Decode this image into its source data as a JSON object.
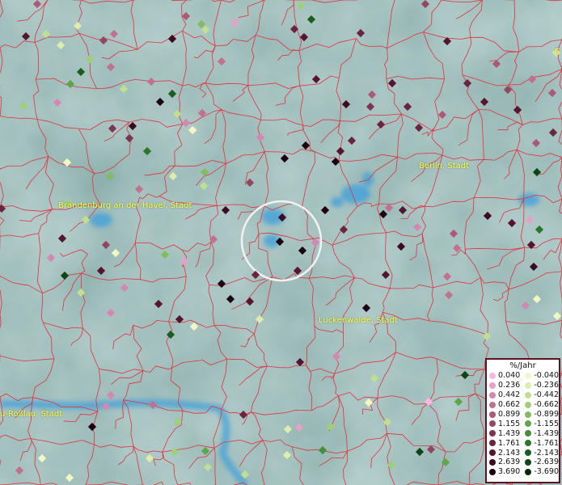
{
  "map": {
    "place_labels": [
      {
        "id": "brandenburg",
        "text": "Brandenburg an der Havel, Stadt"
      },
      {
        "id": "berlin",
        "text": "Berlin, Stadt"
      },
      {
        "id": "luckenwalde",
        "text": "Luckenwalde, Stadt"
      },
      {
        "id": "rosslau",
        "text": "u-Roßlau, Stadt"
      },
      {
        "id": "edge_e",
        "text": "E"
      }
    ],
    "colors": {
      "background": "#8fb1ae",
      "boundary": "#e0323c",
      "water": "#4aa3d8",
      "selection_circle": "#f2f2f2"
    }
  },
  "legend": {
    "title": "%/Jahr",
    "positive": [
      {
        "label": "0.040",
        "color": "#f5b8e0"
      },
      {
        "label": "0.236",
        "color": "#e89fc8"
      },
      {
        "label": "0.442",
        "color": "#d487b0"
      },
      {
        "label": "0.662",
        "color": "#c2708f"
      },
      {
        "label": "0.899",
        "color": "#aa5a78"
      },
      {
        "label": "1.155",
        "color": "#934660"
      },
      {
        "label": "1.439",
        "color": "#7e3350"
      },
      {
        "label": "1.761",
        "color": "#6a2340"
      },
      {
        "label": "2.143",
        "color": "#551530"
      },
      {
        "label": "2.639",
        "color": "#3e0a20"
      },
      {
        "label": "3.690",
        "color": "#1e0210"
      }
    ],
    "negative": [
      {
        "label": "-0.040",
        "color": "#f3f7c4"
      },
      {
        "label": "-0.236",
        "color": "#dcedae"
      },
      {
        "label": "-0.442",
        "color": "#bfe090"
      },
      {
        "label": "-0.662",
        "color": "#9fd076"
      },
      {
        "label": "-0.899",
        "color": "#7fbd5e"
      },
      {
        "label": "-1.155",
        "color": "#5ea748"
      },
      {
        "label": "-1.439",
        "color": "#418f38"
      },
      {
        "label": "-1.761",
        "color": "#2c772a"
      },
      {
        "label": "-2.143",
        "color": "#1a5e1e"
      },
      {
        "label": "-2.639",
        "color": "#0e4514"
      },
      {
        "label": "-3.690",
        "color": "#032a08"
      }
    ]
  }
}
